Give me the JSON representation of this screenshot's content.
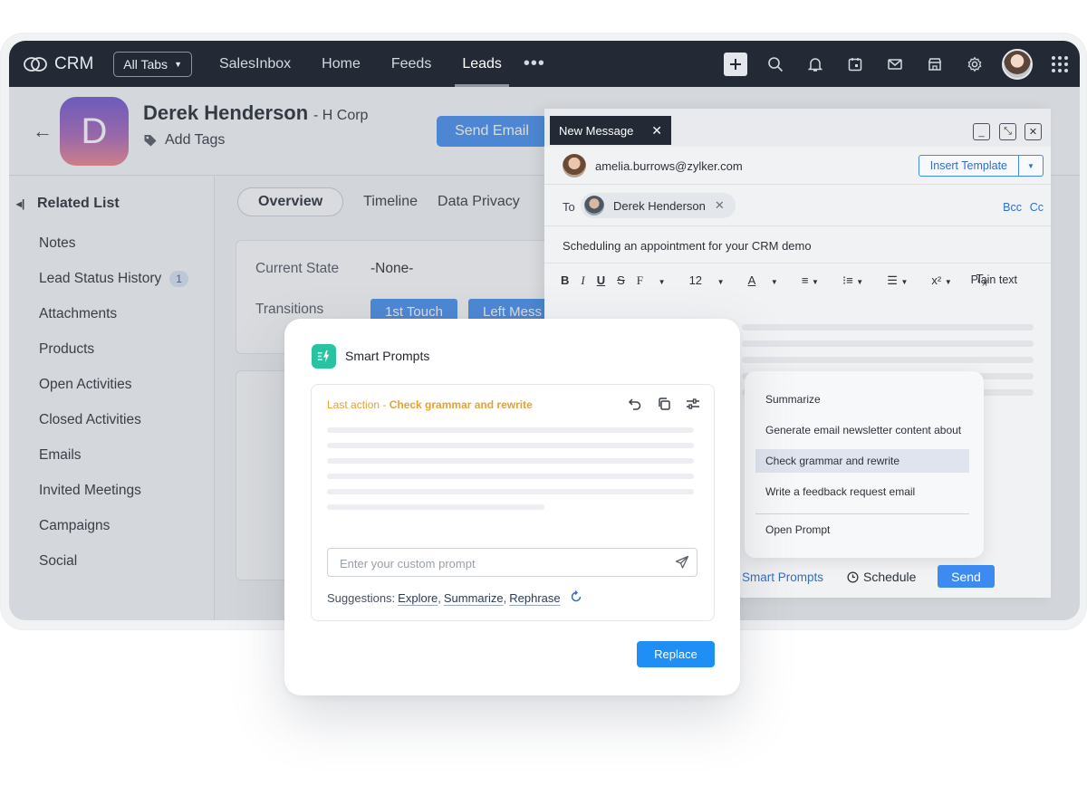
{
  "topbar": {
    "brand": "CRM",
    "all_tabs": "All Tabs",
    "nav": [
      "SalesInbox",
      "Home",
      "Feeds",
      "Leads"
    ],
    "active_nav": "Leads",
    "more": "•••",
    "icons": [
      "plus-icon",
      "search-icon",
      "bell-icon",
      "calendar-icon",
      "mail-icon",
      "store-icon",
      "gear-icon",
      "grid-icon"
    ]
  },
  "record": {
    "avatar_letter": "D",
    "name": "Derek Henderson",
    "company": "- H Corp",
    "add_tags": "Add Tags",
    "send_email": "Send Email"
  },
  "sidebar": {
    "heading": "Related List",
    "items": [
      {
        "label": "Notes"
      },
      {
        "label": "Lead Status History",
        "badge": "1"
      },
      {
        "label": "Attachments"
      },
      {
        "label": "Products"
      },
      {
        "label": "Open Activities"
      },
      {
        "label": "Closed Activities"
      },
      {
        "label": "Emails"
      },
      {
        "label": "Invited Meetings"
      },
      {
        "label": "Campaigns"
      },
      {
        "label": "Social"
      }
    ]
  },
  "main": {
    "tabs": [
      "Overview",
      "Timeline",
      "Data Privacy"
    ],
    "current_state_label": "Current State",
    "current_state_value": "-None-",
    "transitions_label": "Transitions",
    "transitions": [
      "1st Touch",
      "Left Mess"
    ]
  },
  "composer": {
    "tab_title": "New Message",
    "from_email": "amelia.burrows@zylker.com",
    "insert_template": "Insert Template",
    "to_label": "To",
    "recipient": "Derek Henderson",
    "bcc": "Bcc",
    "cc": "Cc",
    "subject": "Scheduling an appointment for your CRM demo",
    "toolbar": [
      "B",
      "I",
      "U",
      "S",
      "F",
      "12",
      "A"
    ],
    "plain_text": "Plain text",
    "smart_prompts_link": "Smart Prompts",
    "schedule": "Schedule",
    "send": "Send"
  },
  "prompt_menu": {
    "items": [
      "Summarize",
      "Generate email newsletter content about",
      "Check grammar and rewrite",
      "Write a feedback request email"
    ],
    "selected": "Check grammar and rewrite",
    "open_prompt": "Open Prompt"
  },
  "smart_prompts": {
    "title": "Smart Prompts",
    "last_action_prefix": "Last action - ",
    "last_action": "Check grammar and rewrite",
    "placeholder": "Enter your custom prompt",
    "suggestions_label": "Suggestions:",
    "suggestions": [
      "Explore",
      "Summarize",
      "Rephrase"
    ],
    "replace": "Replace"
  },
  "colors": {
    "topbar": "#232a36",
    "accent_blue": "#3d8bf0",
    "smart_prompts_icon": "#29c3a2",
    "last_action": "#e7a12f"
  }
}
